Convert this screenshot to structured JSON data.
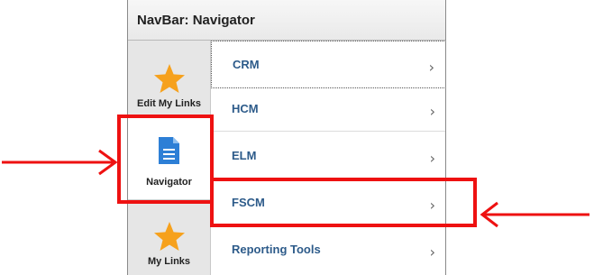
{
  "header": {
    "title": "NavBar: Navigator"
  },
  "sidebar": {
    "tiles": [
      {
        "label": "Edit My Links",
        "icon": "star-icon"
      },
      {
        "label": "Navigator",
        "icon": "document-icon",
        "selected": true
      },
      {
        "label": "My Links",
        "icon": "star-icon"
      }
    ]
  },
  "menu": {
    "items": [
      {
        "label": "CRM",
        "chevron": "›"
      },
      {
        "label": "HCM",
        "chevron": "›"
      },
      {
        "label": "ELM",
        "chevron": "›"
      },
      {
        "label": "FSCM",
        "chevron": "›"
      },
      {
        "label": "Reporting Tools",
        "chevron": "›"
      }
    ]
  },
  "annotations": {
    "color": "#ee1111",
    "highlighted": [
      "Navigator",
      "FSCM"
    ]
  },
  "colors": {
    "star": "#f6a11d",
    "document": "#2d7fd6",
    "link_text": "#2d5b8a"
  }
}
